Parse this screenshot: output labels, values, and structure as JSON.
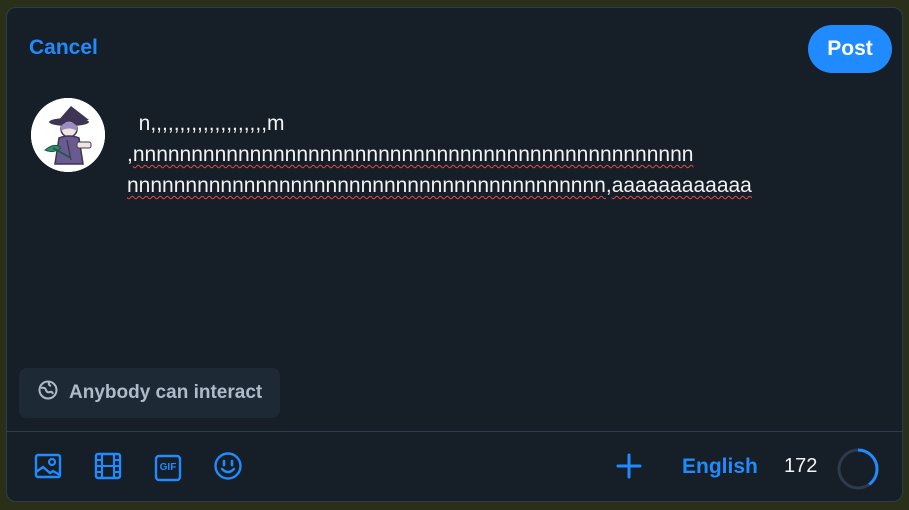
{
  "header": {
    "cancel_label": "Cancel",
    "post_label": "Post"
  },
  "composer": {
    "line1": "  n,,,,,,,,,,,,,,,,,,,,m",
    "line2_comma": ",",
    "line2_word": "nnnnnnnnnnnnnnnnnnnnnnnnnnnnnnnnnnnnnnnnnnnnnnnn",
    "line3_word1": "nnnnnnnnnnnnnnnnnnnnnnnnnnnnnnnnnnnnnnnnn",
    "line3_comma": ",",
    "line3_word2": "aaaaaaaaaaaa"
  },
  "interaction": {
    "label": "Anybody can interact",
    "icon": "globe-icon"
  },
  "toolbar": {
    "icons": [
      "image-icon",
      "video-icon",
      "gif-icon",
      "emoji-icon",
      "plus-icon"
    ],
    "gif_text": "GIF",
    "language": "English",
    "remaining": "172",
    "progress_fraction": 0.4
  },
  "colors": {
    "accent": "#208bfe",
    "background": "#161e27",
    "spellcheck": "#e8484a"
  }
}
